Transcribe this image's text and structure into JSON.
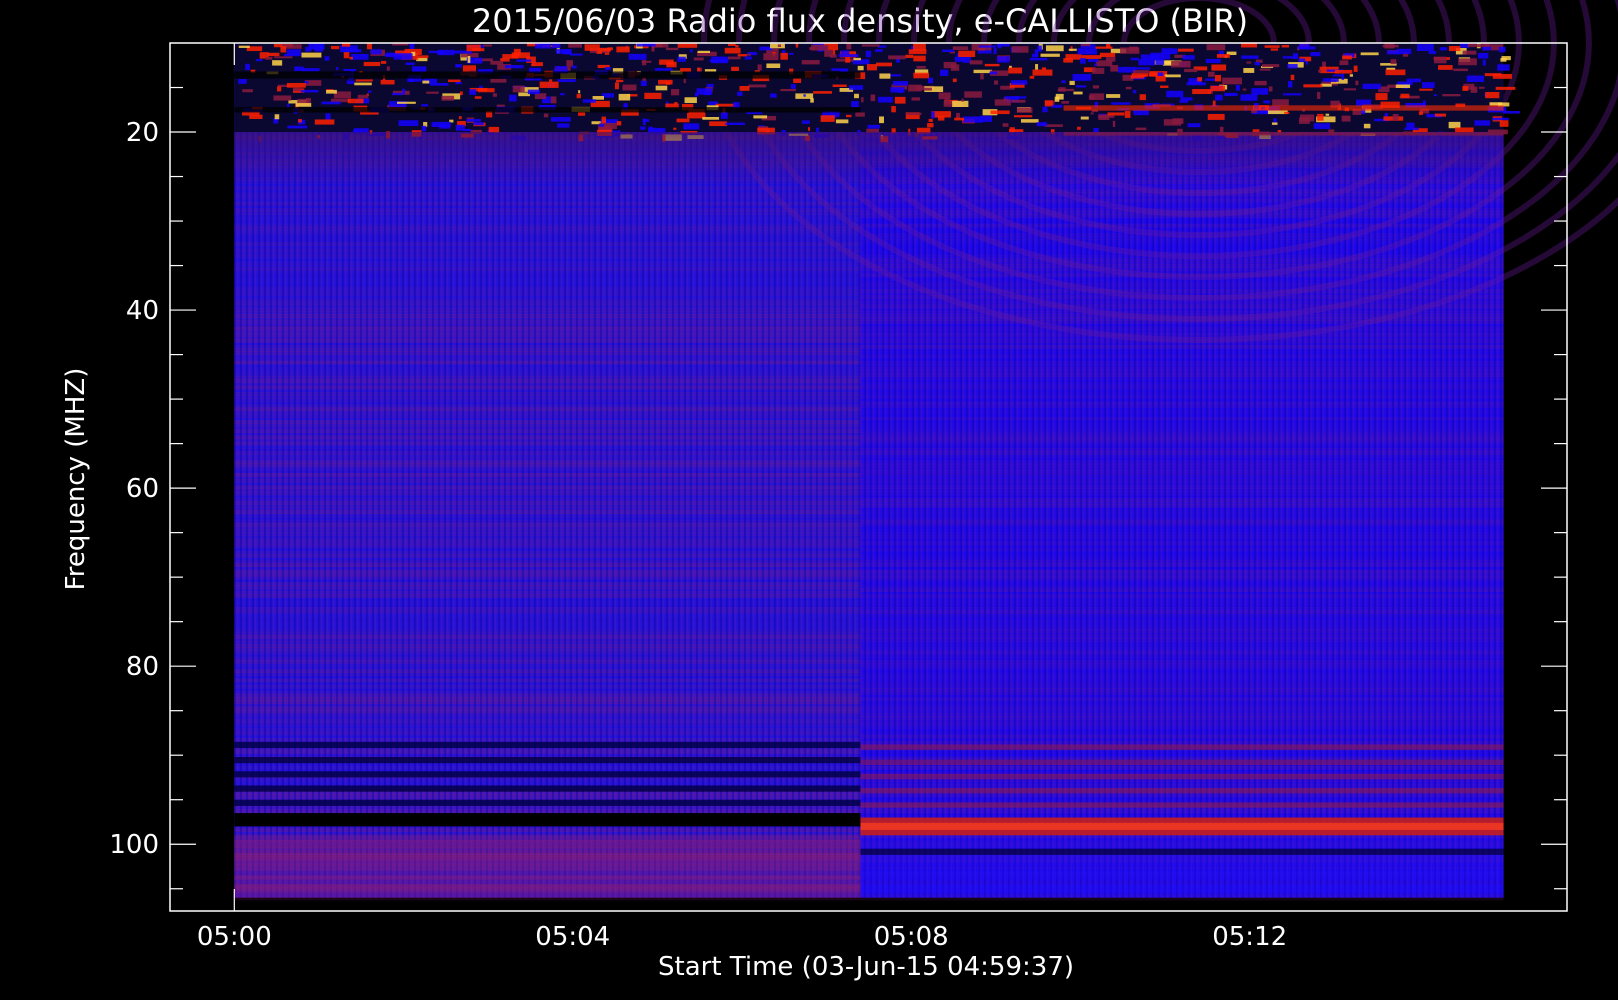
{
  "chart_data": {
    "type": "heatmap",
    "title": "2015/06/03  Radio flux density, e-CALLISTO (BIR)",
    "xlabel": "Start Time (03-Jun-15 04:59:37)",
    "ylabel": "Frequency (MHZ)",
    "x_ticks": [
      {
        "label": "05:00",
        "minutes": 0
      },
      {
        "label": "05:04",
        "minutes": 4
      },
      {
        "label": "05:08",
        "minutes": 8
      },
      {
        "label": "05:12",
        "minutes": 12
      }
    ],
    "x_range_minutes": [
      -0.76,
      15.75
    ],
    "x_minor_step_minutes": 1,
    "data_time_range_minutes": [
      0,
      15
    ],
    "instrument_switch_minutes": 7.4,
    "y_ticks": [
      20,
      40,
      60,
      80,
      100
    ],
    "y_minor_step": 5,
    "ylim": [
      10,
      107.5
    ],
    "y_inverted": true,
    "data_freq_range_mhz": [
      10,
      106
    ],
    "colormap": [
      "#000000",
      "#1400ff",
      "#8a2060",
      "#ff2000",
      "#ffd24a"
    ],
    "features": [
      {
        "name": "bright interference band",
        "freq_mhz": [
          10,
          20
        ],
        "time_min": [
          0,
          15
        ]
      },
      {
        "name": "dark band",
        "freq_mhz": [
          96.5,
          98
        ],
        "time_min": [
          0,
          7.4
        ]
      },
      {
        "name": "red band",
        "freq_mhz": [
          97,
          99
        ],
        "time_min": [
          7.4,
          15
        ]
      },
      {
        "name": "banded region",
        "freq_mhz": [
          88,
          95
        ],
        "time_min": [
          0,
          15
        ]
      }
    ]
  }
}
